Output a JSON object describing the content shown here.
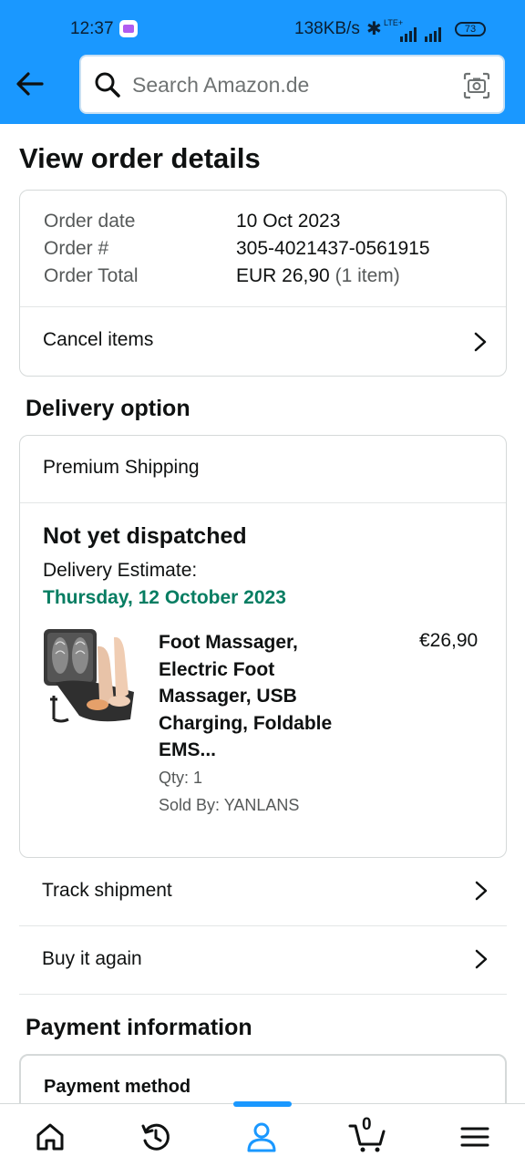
{
  "status_bar": {
    "time": "12:37",
    "network_speed": "138KB/s",
    "network_type": "LTE+",
    "battery": "73"
  },
  "search": {
    "placeholder": "Search Amazon.de"
  },
  "page_title": "View order details",
  "order_summary": {
    "rows": [
      {
        "label": "Order date",
        "value": "10 Oct 2023"
      },
      {
        "label": "Order #",
        "value": "305-4021437-0561915"
      },
      {
        "label": "Order Total",
        "value": "EUR 26,90",
        "note": "(1 item)"
      }
    ],
    "cancel_label": "Cancel items"
  },
  "delivery": {
    "heading": "Delivery option",
    "shipping_type": "Premium Shipping",
    "status": "Not yet dispatched",
    "estimate_label": "Delivery Estimate:",
    "estimate_date": "Thursday, 12 October 2023",
    "item": {
      "title_lines": [
        "Foot Massager,",
        "Electric Foot",
        "Massager, USB",
        "Charging, Foldable",
        "EMS..."
      ],
      "price": "€26,90",
      "qty": "Qty: 1",
      "seller": "Sold By: YANLANS"
    }
  },
  "actions": {
    "track_label": "Track shipment",
    "buy_again_label": "Buy it again"
  },
  "payment": {
    "heading": "Payment information",
    "method_label": "Payment method"
  },
  "bottom_nav": {
    "cart_count": "0",
    "items": [
      "home-icon",
      "refresh-icon",
      "account-icon",
      "cart-icon",
      "menu-icon"
    ]
  },
  "colors": {
    "header_blue": "#1a98ff",
    "delivery_green": "#067d62",
    "border": "#d5d9d9"
  }
}
